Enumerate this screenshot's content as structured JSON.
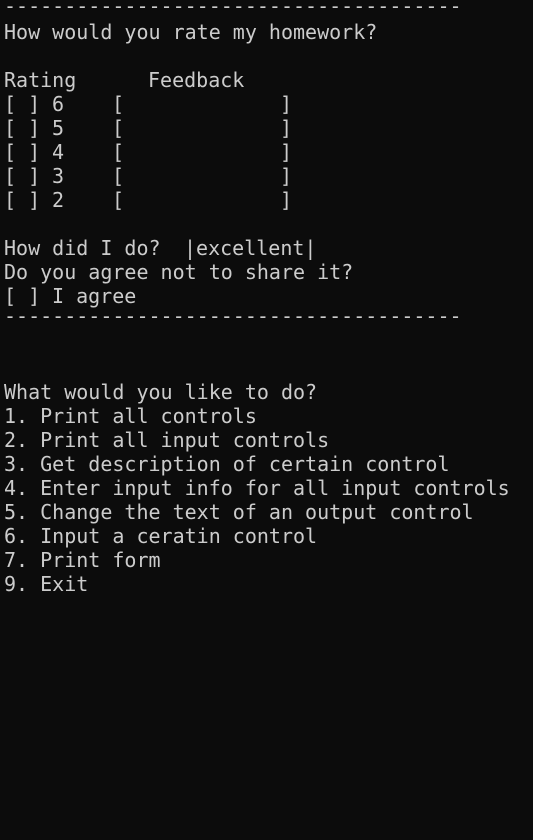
{
  "form": {
    "separator": "--------------------------------------",
    "question": "How would you rate my homework?",
    "headers": {
      "rating": "Rating",
      "feedback": "Feedback"
    },
    "rows": [
      {
        "checkbox": "[ ]",
        "value": "6",
        "feedback_open": "[",
        "feedback_close": "]"
      },
      {
        "checkbox": "[ ]",
        "value": "5",
        "feedback_open": "[",
        "feedback_close": "]"
      },
      {
        "checkbox": "[ ]",
        "value": "4",
        "feedback_open": "[",
        "feedback_close": "]"
      },
      {
        "checkbox": "[ ]",
        "value": "3",
        "feedback_open": "[",
        "feedback_close": "]"
      },
      {
        "checkbox": "[ ]",
        "value": "2",
        "feedback_open": "[",
        "feedback_close": "]"
      }
    ],
    "how_label": "How did I do?",
    "how_value": "|excellent|",
    "agree_question": "Do you agree not to share it?",
    "agree_checkbox": "[ ]",
    "agree_label": "I agree"
  },
  "menu": {
    "prompt": "What would you like to do?",
    "items": [
      "1. Print all controls",
      "2. Print all input controls",
      "3. Get description of certain control",
      "4. Enter input info for all input controls",
      "5. Change the text of an output control",
      "6. Input a ceratin control",
      "7. Print form",
      "9. Exit"
    ]
  }
}
